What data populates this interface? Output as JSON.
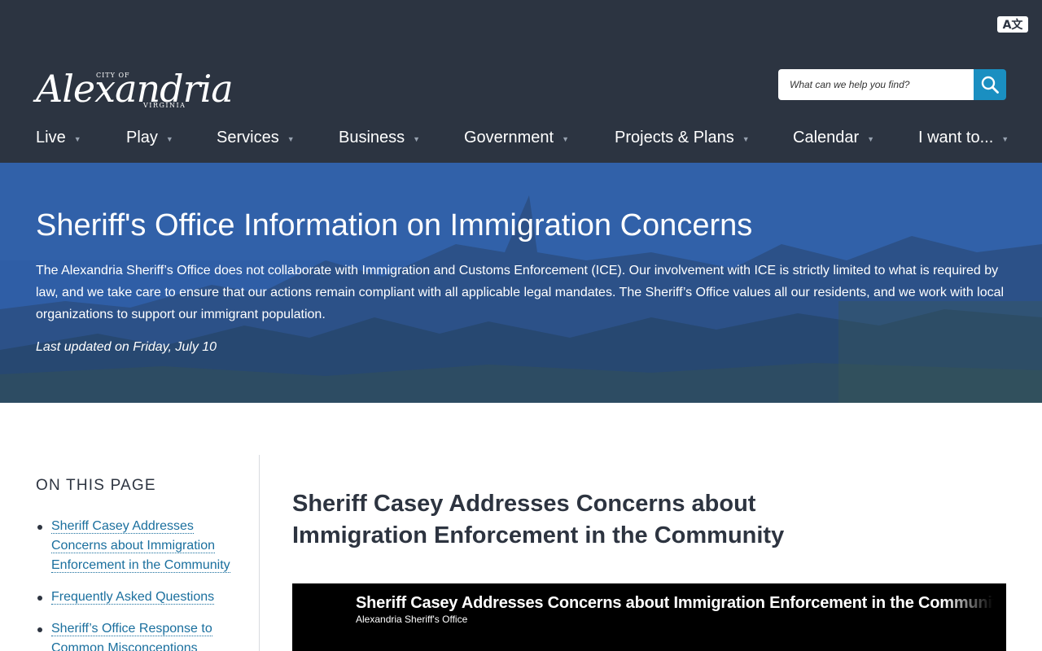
{
  "header": {
    "translate_label": "A文",
    "logo": {
      "city_of": "CITY OF",
      "name": "Alexandria",
      "state": "VIRGINIA"
    },
    "search": {
      "placeholder": "What can we help you find?",
      "icon": "search-icon"
    },
    "nav": [
      {
        "label": "Live"
      },
      {
        "label": "Play"
      },
      {
        "label": "Services"
      },
      {
        "label": "Business"
      },
      {
        "label": "Government"
      },
      {
        "label": "Projects & Plans"
      },
      {
        "label": "Calendar"
      },
      {
        "label": "I want to..."
      }
    ],
    "caret": "▼"
  },
  "hero": {
    "title": "Sheriff's Office Information on Immigration Concerns",
    "description": "The Alexandria Sheriff’s Office does not collaborate with Immigration and Customs Enforcement (ICE). Our involvement with ICE is strictly limited to what is required by law, and we take care to ensure that our actions remain compliant with all applicable legal mandates. The Sheriff’s Office values all our residents, and we work with local organizations to support our immigrant population.",
    "last_updated": "Last updated on Friday, July 10"
  },
  "sidebar": {
    "heading": "ON THIS PAGE",
    "links": [
      {
        "label": "Sheriff Casey Addresses Concerns about Immigration Enforcement in the Community"
      },
      {
        "label": "Frequently Asked Questions"
      },
      {
        "label": "Sheriff’s Office Response to Common Misconceptions"
      }
    ]
  },
  "main": {
    "heading": "Sheriff Casey Addresses Concerns about Immigration Enforcement in the Community",
    "video": {
      "title": "Sheriff Casey Addresses Concerns about Immigration Enforcement in the Community",
      "channel": "Alexandria Sheriff's Office"
    }
  },
  "colors": {
    "header_bg": "#2c3441",
    "search_button": "#1a8fc1",
    "link": "#1a6f9e",
    "hero_overlay": "#2e5a9c"
  }
}
